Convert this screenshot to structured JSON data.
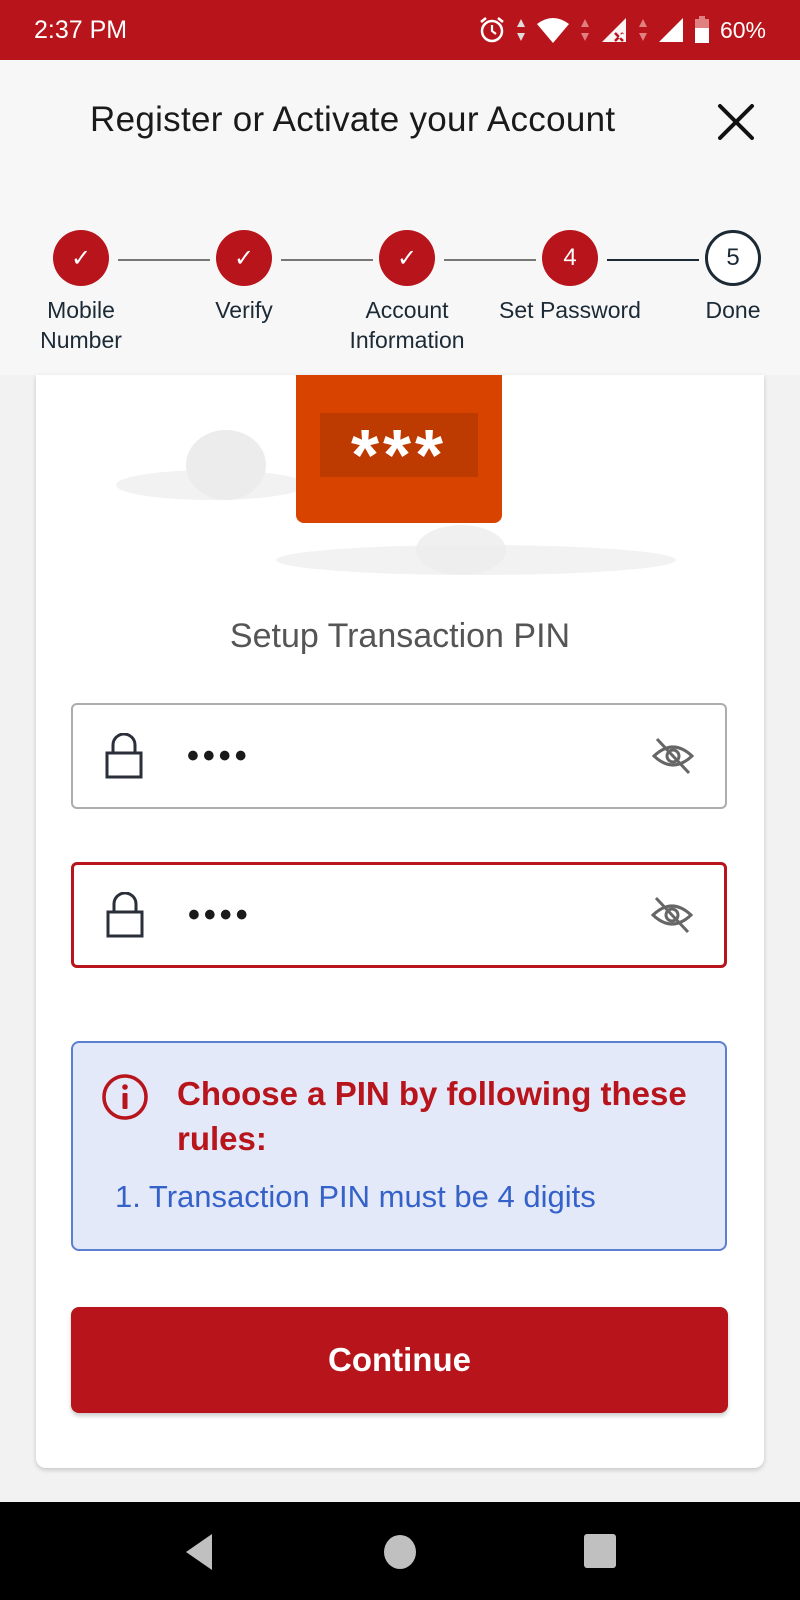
{
  "status_bar": {
    "time": "2:37 PM",
    "battery": "60%",
    "icons": [
      "alarm-icon",
      "wifi-icon",
      "signal-no-sim-icon",
      "signal-icon",
      "battery-icon"
    ]
  },
  "header": {
    "title": "Register or Activate your Account",
    "close_icon": "close-icon"
  },
  "stepper": {
    "steps": [
      {
        "label": "Mobile Number",
        "marker": "✓",
        "state": "done"
      },
      {
        "label": "Verify",
        "marker": "✓",
        "state": "done"
      },
      {
        "label": "Account Information",
        "marker": "✓",
        "state": "done"
      },
      {
        "label": "Set Password",
        "marker": "4",
        "state": "active"
      },
      {
        "label": "Done",
        "marker": "5",
        "state": "pending"
      }
    ]
  },
  "hero": {
    "pin_graphic_text": "***"
  },
  "form": {
    "title": "Setup Transaction PIN",
    "pin_field": {
      "value": "••••",
      "state": "normal"
    },
    "confirm_pin_field": {
      "value": "••••",
      "state": "error"
    }
  },
  "rules": {
    "title": "Choose a PIN by following these rules:",
    "items": [
      "1. Transaction PIN must be 4 digits"
    ]
  },
  "actions": {
    "continue_label": "Continue"
  },
  "colors": {
    "brand_red": "#b8141b",
    "pin_orange": "#d84300",
    "info_blue": "#3562c9",
    "info_bg": "#e4e9f9"
  }
}
